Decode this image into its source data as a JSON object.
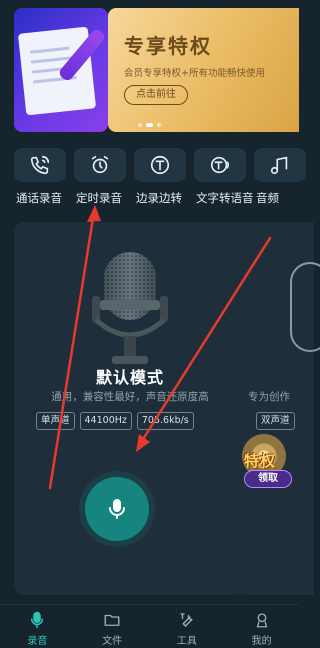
{
  "banner": {
    "title": "专享特权",
    "subtitle": "会员专享特权+所有功能畅快使用",
    "button_label": "点击前往",
    "page_count": 3,
    "active_page": 2
  },
  "tools": [
    {
      "label": "通话录音",
      "icon": "phone-call-icon"
    },
    {
      "label": "定时录音",
      "icon": "alarm-clock-icon"
    },
    {
      "label": "边录边转",
      "icon": "t-convert-icon"
    },
    {
      "label": "文字转语音",
      "icon": "text-to-speech-icon"
    },
    {
      "label": "音频",
      "icon": "audio-icon"
    }
  ],
  "mode_card": {
    "title": "默认模式",
    "description": "通用，兼容性最好，声音还原度高",
    "tags": [
      "单声道",
      "44100Hz",
      "705.6kb/s"
    ]
  },
  "mode_card_2": {
    "description": "专为创作",
    "tag": "双声道"
  },
  "promo_badge": {
    "word": "特权",
    "button": "领取"
  },
  "bottom_nav": [
    {
      "label": "录音",
      "icon": "mic-icon",
      "active": true
    },
    {
      "label": "文件",
      "icon": "folder-icon",
      "active": false
    },
    {
      "label": "工具",
      "icon": "tools-icon",
      "active": false
    },
    {
      "label": "我的",
      "icon": "user-icon",
      "active": false
    }
  ],
  "colors": {
    "background": "#16242e",
    "card": "#1e2f3b",
    "accent": "#17857f",
    "annotation_arrow": "#e53a2c"
  }
}
